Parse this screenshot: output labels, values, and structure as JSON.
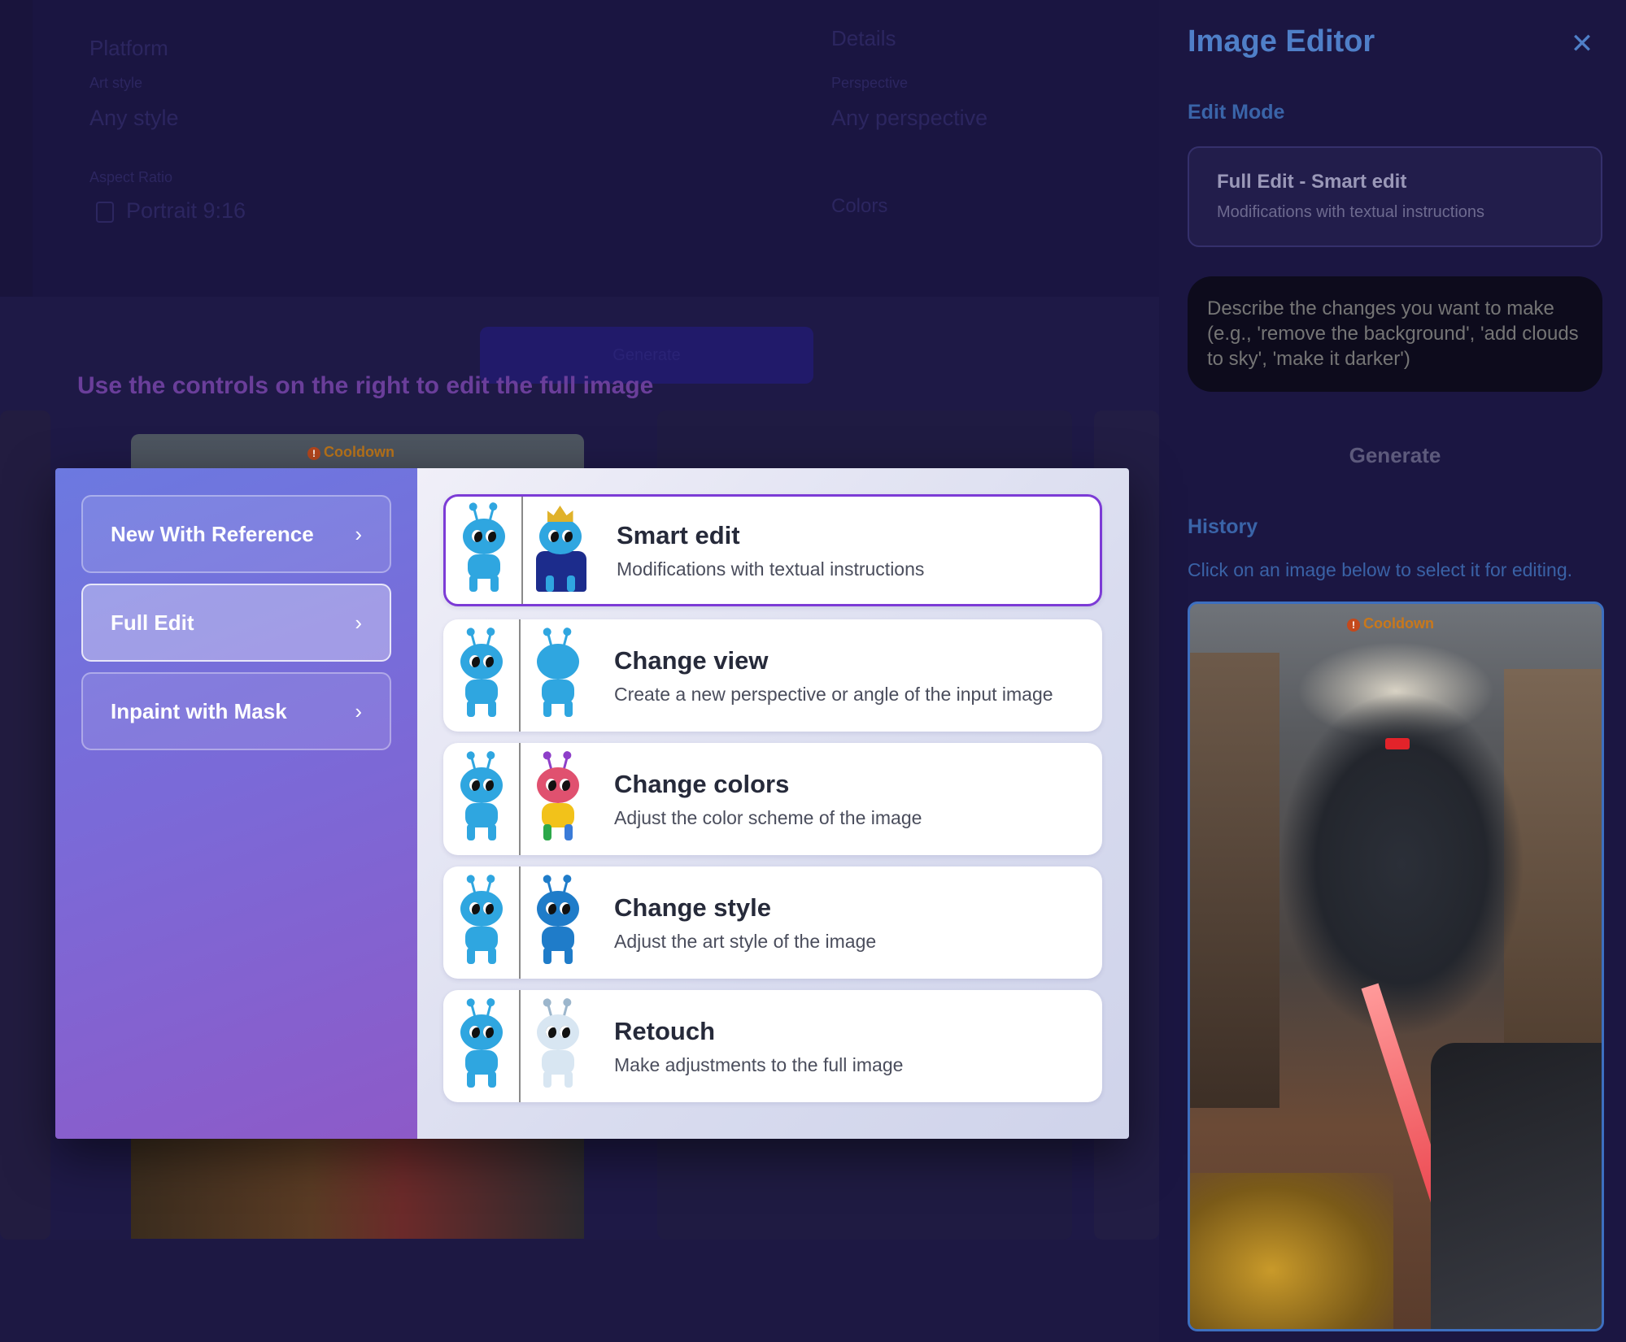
{
  "background": {
    "fields": [
      {
        "label": "Platform",
        "sub_label": "Art style",
        "value": "Any style"
      },
      {
        "label": "Details",
        "sub_label": "Perspective",
        "value": "Any perspective"
      }
    ],
    "aspect_label": "Aspect Ratio",
    "aspect_value": "Portrait 9:16",
    "colors_label": "Colors",
    "generate_label": "Generate",
    "hint": "Use the controls on the right to edit the full image",
    "thumb_badge": "Cooldown"
  },
  "panel": {
    "title": "Image Editor",
    "close_icon": "close-icon",
    "edit_mode_label": "Edit Mode",
    "mode_card": {
      "title": "Full Edit - Smart edit",
      "subtitle": "Modifications with textual instructions"
    },
    "description_placeholder": "Describe the changes you want to make (e.g., 'remove the background', 'add clouds to sky', 'make it darker')",
    "generate_label": "Generate",
    "history_label": "History",
    "history_hint": "Click on an image below to select it for editing.",
    "history_badge": "Cooldown"
  },
  "modal": {
    "categories": [
      {
        "label": "New With Reference",
        "active": false
      },
      {
        "label": "Full Edit",
        "active": true
      },
      {
        "label": "Inpaint with Mask",
        "active": false
      }
    ],
    "options": [
      {
        "title": "Smart edit",
        "subtitle": "Modifications with textual instructions",
        "selected": true,
        "after_style": "dark-crowned"
      },
      {
        "title": "Change view",
        "subtitle": "Create a new perspective or angle of the input image",
        "selected": false,
        "after_style": "blue-side"
      },
      {
        "title": "Change colors",
        "subtitle": "Adjust the color scheme of the image",
        "selected": false,
        "after_style": "multicolor"
      },
      {
        "title": "Change style",
        "subtitle": "Adjust the art style of the image",
        "selected": false,
        "after_style": "dark"
      },
      {
        "title": "Retouch",
        "subtitle": "Make adjustments to the full image",
        "selected": false,
        "after_style": "white"
      }
    ]
  },
  "colors": {
    "accent_blue": "#4f7fc8",
    "selected_border": "#7c3bd6",
    "modal_gradient_start": "#6c79e0",
    "modal_gradient_end": "#8d5ac8"
  }
}
